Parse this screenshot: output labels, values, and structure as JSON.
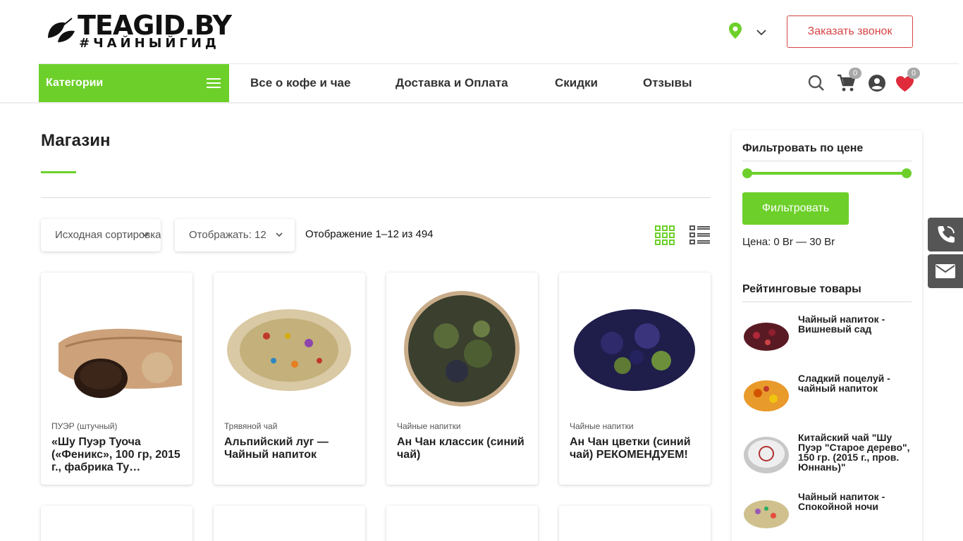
{
  "header": {
    "logo_title": "TEAGID.BY",
    "logo_subtitle": "#ЧАЙНЫЙГИД",
    "call_button": "Заказать звонок",
    "cart_count": "0",
    "wishlist_count": "0"
  },
  "nav": {
    "categories": "Категории",
    "items": [
      {
        "label": "Все о кофе и чае"
      },
      {
        "label": "Доставка и Оплата"
      },
      {
        "label": "Скидки"
      },
      {
        "label": "Отзывы"
      }
    ]
  },
  "main": {
    "title": "Магазин",
    "sort_select": "Исходная сортировка",
    "per_page_select": "Отображать: 12",
    "result_count": "Отображение 1–12 из 494",
    "products": [
      {
        "category": "ПУЭР (штучный)",
        "name": "«Шу Пуэр Туоча («Феникс», 100 гр, 2015 г., фабрика Ту…"
      },
      {
        "category": "Трявяной чай",
        "name": "Альпийский луг — Чайный напиток"
      },
      {
        "category": "Чайные напитки",
        "name": "Ан Чан классик (синий чай)"
      },
      {
        "category": "Чайные напитки",
        "name": "Ан Чан цветки (синий чай) РЕКОМЕНДУЕМ!"
      }
    ]
  },
  "sidebar": {
    "price_filter_title": "Фильтровать по цене",
    "filter_button": "Фильтровать",
    "price_range": "Цена: 0 Br — 30 Br",
    "rated_title": "Рейтинговые товары",
    "rated_items": [
      {
        "name": "Чайный напиток - Вишневый сад"
      },
      {
        "name": "Сладкий поцелуй - чайный напиток"
      },
      {
        "name": "Китайский чай \"Шу Пуэр \"Старое дерево\", 150 гр. (2015 г., пров. Юннань)\""
      },
      {
        "name": "Чайный напиток - Спокойной ночи"
      }
    ]
  },
  "colors": {
    "accent_green": "#6dd02a",
    "call_red": "#d64545",
    "side_tab_gray": "#555555"
  },
  "icons": [
    "leaf-logo-icon",
    "location-pin-icon",
    "chevron-down-icon",
    "menu-icon",
    "search-icon",
    "cart-icon",
    "user-icon",
    "heart-icon",
    "grid-view-icon",
    "list-view-icon",
    "phone-icon",
    "mail-icon"
  ]
}
